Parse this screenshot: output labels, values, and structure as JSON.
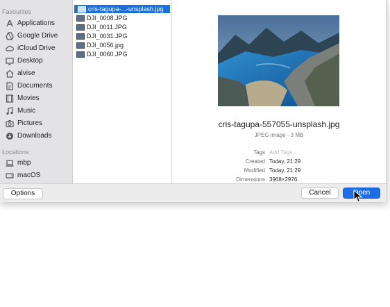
{
  "sidebar": {
    "favourites_heading": "Favourites",
    "favourites": [
      {
        "label": "Applications",
        "icon": "applications-icon"
      },
      {
        "label": "Google Drive",
        "icon": "google-drive-icon"
      },
      {
        "label": "iCloud Drive",
        "icon": "cloud-icon"
      },
      {
        "label": "Desktop",
        "icon": "desktop-icon"
      },
      {
        "label": "alvise",
        "icon": "home-icon"
      },
      {
        "label": "Documents",
        "icon": "documents-icon"
      },
      {
        "label": "Movies",
        "icon": "film-icon"
      },
      {
        "label": "Music",
        "icon": "music-note-icon"
      },
      {
        "label": "Pictures",
        "icon": "camera-icon"
      },
      {
        "label": "Downloads",
        "icon": "download-icon"
      }
    ],
    "locations_heading": "Locations",
    "locations": [
      {
        "label": "mbp",
        "icon": "laptop-icon"
      },
      {
        "label": "macOS",
        "icon": "disk-icon"
      }
    ]
  },
  "files": [
    {
      "name": "cris-tagupa-...-unsplash.jpg",
      "selected": true
    },
    {
      "name": "DJI_0008.JPG"
    },
    {
      "name": "DJI_0011.JPG"
    },
    {
      "name": "DJI_0031.JPG"
    },
    {
      "name": "DJI_0056.jpg"
    },
    {
      "name": "DJI_0060.JPG"
    }
  ],
  "preview": {
    "filename": "cris-tagupa-557055-unsplash.jpg",
    "type": "JPEG image - 3 MB",
    "tags_label": "Tags",
    "tags_placeholder": "Add Tags...",
    "created_label": "Created",
    "created": "Today, 21:29",
    "modified_label": "Modified",
    "modified": "Today, 21:29",
    "dimensions_label": "Dimensions",
    "dimensions": "3968×2976"
  },
  "footer": {
    "options": "Options",
    "cancel": "Cancel",
    "open": "Open"
  },
  "colors": {
    "selection": "#1f6fd8",
    "primary_button": "#1d6ee6",
    "sidebar_bg": "#e3e3e5",
    "dialog_bg": "#ececec"
  }
}
